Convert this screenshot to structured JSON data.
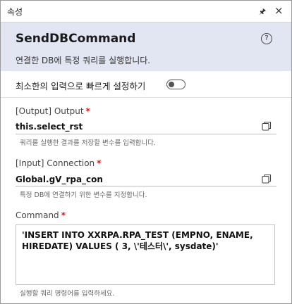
{
  "panel": {
    "title": "속성"
  },
  "header": {
    "command_name": "SendDBCommand",
    "description": "연결한 DB에 특정 쿼리를 실행합니다."
  },
  "quick_setup": {
    "label": "최소한의 입력으로 빠르게 설정하기",
    "enabled": false
  },
  "fields": {
    "output": {
      "label": "[Output] Output",
      "required_mark": "*",
      "value": "this.select_rst",
      "hint": "쿼리를 실행한 결과를 저장할 변수를 입력합니다."
    },
    "connection": {
      "label": "[Input] Connection",
      "required_mark": "*",
      "value": "Global.gV_rpa_con",
      "hint": "특정 DB에 연결하기 위한 변수를 지정합니다."
    },
    "command": {
      "label": "Command",
      "required_mark": "*",
      "value": "'INSERT INTO XXRPA.RPA_TEST (EMPNO, ENAME, HIREDATE) VALUES ( 3, \\'테스터\\', sysdate)'",
      "hint": "실행할 쿼리 명령어를 입력하세요."
    }
  },
  "icons": {
    "pin": "pin-icon",
    "close": "close-icon",
    "help": "help-icon",
    "copy": "copy-icon"
  }
}
